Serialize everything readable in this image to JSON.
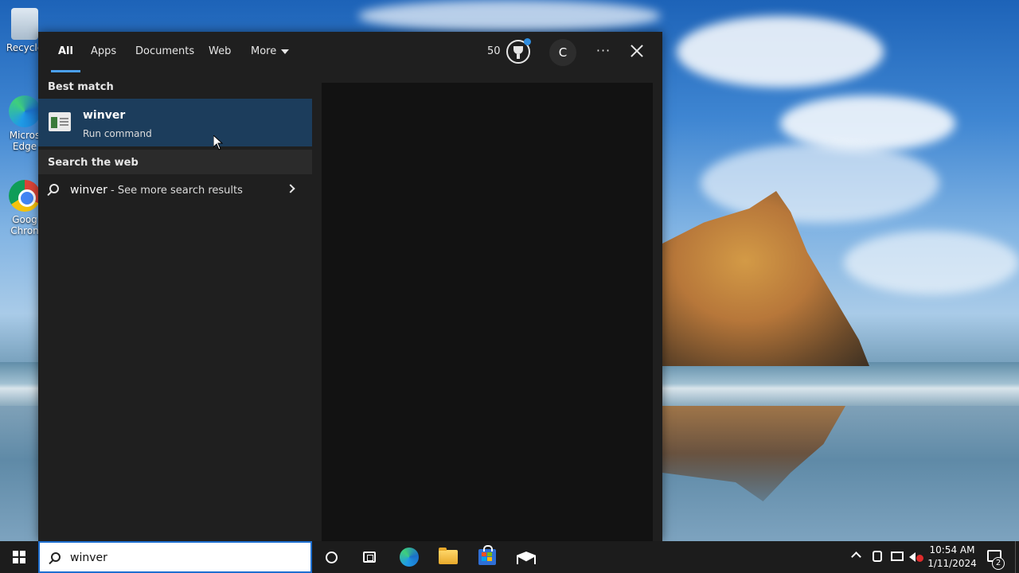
{
  "desktop": {
    "icons": [
      {
        "label": "Recycle",
        "icon": "recycle-bin-icon"
      },
      {
        "label": "Micros Edge",
        "icon": "edge-icon"
      },
      {
        "label": "Goog Chron",
        "icon": "chrome-icon"
      }
    ]
  },
  "search_flyout": {
    "tabs": [
      {
        "label": "All",
        "active": true
      },
      {
        "label": "Apps"
      },
      {
        "label": "Documents"
      },
      {
        "label": "Web"
      },
      {
        "label": "More"
      }
    ],
    "rewards_points": "50",
    "avatar_initial": "C",
    "more_options_label": "···",
    "best_match_header": "Best match",
    "best_match": {
      "title": "winver",
      "subtitle": "Run command"
    },
    "search_web_header": "Search the web",
    "web_result": {
      "query": "winver",
      "suffix": " - See more search results"
    }
  },
  "taskbar": {
    "search_value": "winver",
    "clock_time": "10:54 AM",
    "clock_date": "1/11/2024",
    "notification_count": "2"
  },
  "colors": {
    "accent": "#4aa0f0",
    "selected_item": "#1c3d5c",
    "flyout_bg": "#1f1f1f",
    "preview_bg": "#121212",
    "taskbar_bg": "#1c1c1c"
  }
}
